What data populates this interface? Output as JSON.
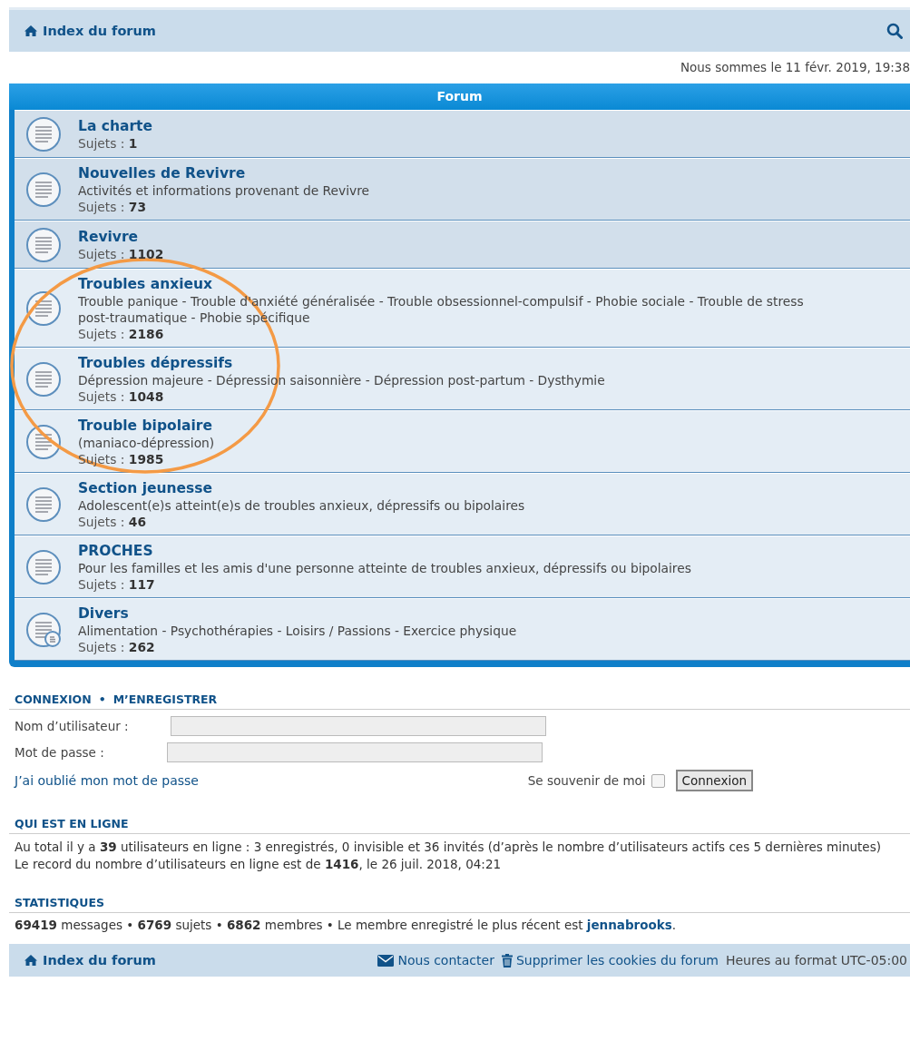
{
  "navbar": {
    "home_link": "Index du forum"
  },
  "date_line": "Nous sommes le 11 févr. 2019, 19:38",
  "forum_table": {
    "header": "Forum",
    "forums": [
      {
        "title": "La charte",
        "topics": "Sujets : **1**",
        "kind": "forum"
      },
      {
        "title": "Nouvelles de Revivre",
        "description": "Activités et informations provenant de Revivre",
        "topics": "Sujets : **73**",
        "kind": "forum"
      },
      {
        "title": "Revivre",
        "topics": "Sujets : **1102**",
        "kind": "forum"
      },
      {
        "title": "Troubles anxieux",
        "description": "Trouble panique - Trouble d'anxiété généralisée - Trouble obsessionnel-compulsif - Phobie sociale - Trouble de stress post-traumatique - Phobie spécifique",
        "topics": "Sujets : **2186**",
        "kind": "forum"
      },
      {
        "title": "Troubles dépressifs",
        "description": "Dépression majeure - Dépression saisonnière - Dépression post-partum - Dysthymie",
        "topics": "Sujets : **1048**",
        "kind": "forum"
      },
      {
        "title": "Trouble bipolaire",
        "description": "(maniaco-dépression)",
        "topics": "Sujets : **1985**",
        "kind": "forum"
      },
      {
        "title": "Section jeunesse",
        "description": "Adolescent(e)s atteint(e)s de troubles anxieux, dépressifs ou bipolaires",
        "topics": "Sujets : **46**",
        "kind": "forum"
      },
      {
        "title": "PROCHES",
        "description": "Pour les familles et les amis d'une personne atteinte de troubles anxieux, dépressifs ou bipolaires",
        "topics": "Sujets : **117**",
        "kind": "forum"
      },
      {
        "title": "Divers",
        "description": "Alimentation - Psychothérapies - Loisirs / Passions - Exercice physique",
        "topics": "Sujets : **262**",
        "kind": "forum-with-subforums"
      }
    ],
    "annotation": {
      "kind": "ellipse"
    }
  },
  "login": {
    "heading_login": "CONNEXION",
    "separator": "•",
    "heading_register": "M’ENREGISTRER",
    "username_label": "Nom d’utilisateur :",
    "password_label": "Mot de passe :",
    "forgot_link": "J’ai oublié mon mot de passe",
    "remember_label": "Se souvenir de moi",
    "remember_checked": false,
    "submit": "Connexion"
  },
  "online": {
    "heading": "QUI EST EN LIGNE",
    "text": "Au total il y a **39** utilisateurs en ligne : 3 enregistrés, 0 invisible et 36 invités (d’après le nombre d’utilisateurs actifs ces 5 dernières minutes)",
    "record": "Le record du nombre d’utilisateurs en ligne est de **1416**, le 26 juil. 2018, 04:21"
  },
  "statistics": {
    "heading": "STATISTIQUES",
    "text": "**69419** messages • **6769** sujets • **6862** membres • Le membre enregistré le plus récent est",
    "newest_member": "jennabrooks",
    "end": "."
  },
  "footer": {
    "home_link": "Index du forum",
    "contact_link": "Nous contacter",
    "cookies_link": "Supprimer les cookies du forum",
    "timezone": "Heures au format UTC-05:00"
  }
}
